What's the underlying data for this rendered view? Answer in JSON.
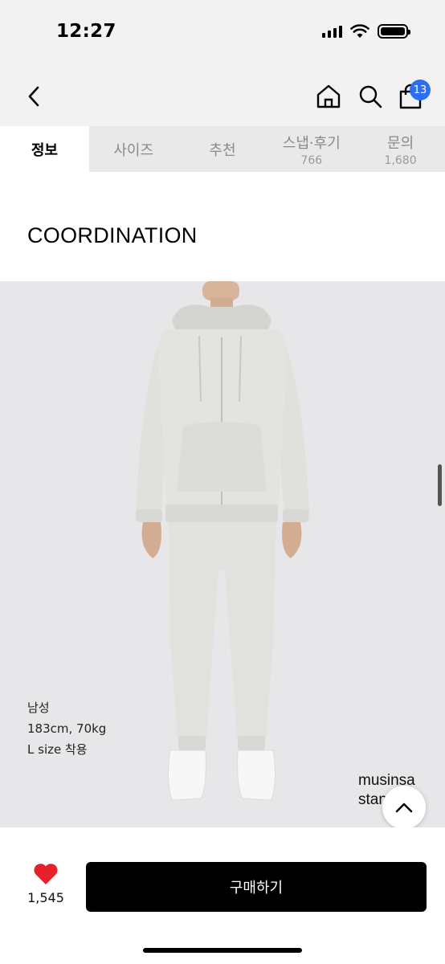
{
  "status_bar": {
    "time": "12:27"
  },
  "nav": {
    "cart_badge": "13",
    "icons": [
      "back-arrow-icon",
      "home-icon",
      "search-icon",
      "shopping-bag-icon"
    ]
  },
  "tabs": [
    {
      "label": "정보",
      "count": "",
      "active": true
    },
    {
      "label": "사이즈",
      "count": ""
    },
    {
      "label": "추천",
      "count": ""
    },
    {
      "label": "스냅·후기",
      "count": "766"
    },
    {
      "label": "문의",
      "count": "1,680"
    }
  ],
  "section": {
    "title": "COORDINATION"
  },
  "product_image": {
    "caption": [
      "남성",
      "183cm, 70kg",
      "L size 착용"
    ],
    "brand": [
      "musinsa",
      "standard"
    ]
  },
  "bottom": {
    "like_count": "1,545",
    "buy_label": "구매하기"
  },
  "colors": {
    "accent": "#2c6ef2",
    "heart": "#e8202a",
    "buy_button": "#000000",
    "tab_bar": "#e9e9e9"
  }
}
